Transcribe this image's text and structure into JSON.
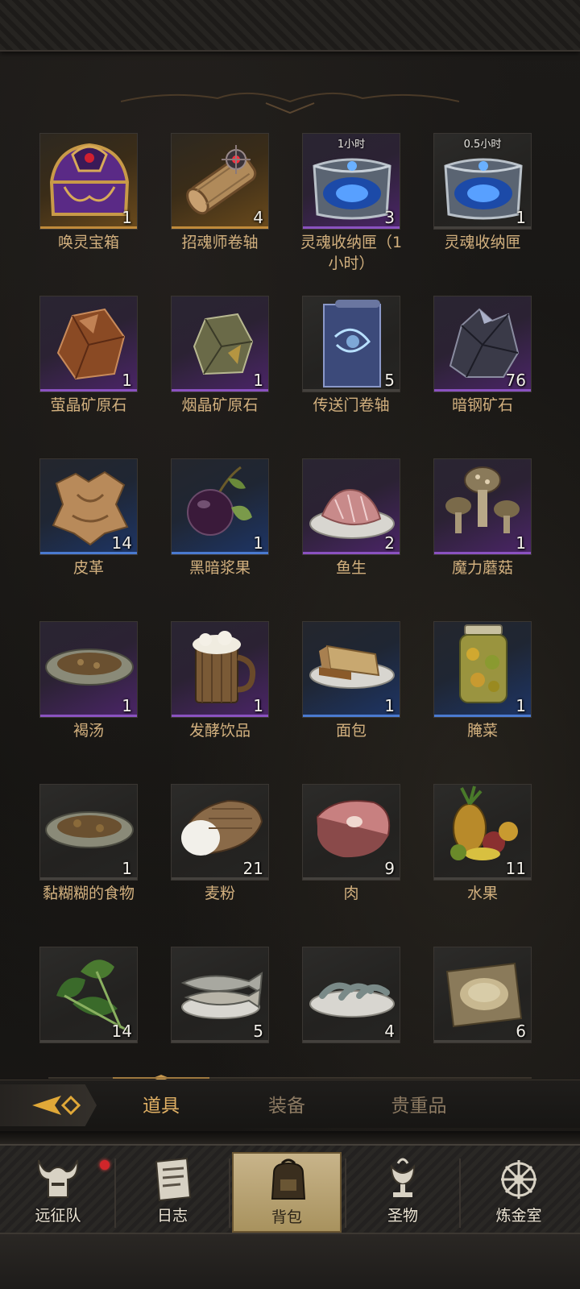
{
  "inventory": {
    "items": [
      {
        "name": "唤灵宝箱",
        "count": "1",
        "rarity": "gold",
        "icon": "purple-ornate-chest-icon"
      },
      {
        "name": "招魂师卷轴",
        "count": "4",
        "rarity": "gold",
        "icon": "scroll-with-red-gem-icon"
      },
      {
        "name": "灵魂收纳匣（1小时）",
        "count": "3",
        "rarity": "purple",
        "icon": "soul-box-icon",
        "timer": "1小时"
      },
      {
        "name": "灵魂收纳匣",
        "count": "1",
        "rarity": "gray",
        "icon": "soul-box-icon",
        "timer": "0.5小时"
      },
      {
        "name": "萤晶矿原石",
        "count": "1",
        "rarity": "purple",
        "icon": "amber-ore-icon"
      },
      {
        "name": "烟晶矿原石",
        "count": "1",
        "rarity": "purple",
        "icon": "smoky-ore-icon"
      },
      {
        "name": "传送门卷轴",
        "count": "5",
        "rarity": "gray",
        "icon": "portal-scroll-icon"
      },
      {
        "name": "暗钢矿石",
        "count": "76",
        "rarity": "purple",
        "icon": "dark-steel-ore-icon"
      },
      {
        "name": "皮革",
        "count": "14",
        "rarity": "blue",
        "icon": "leather-hide-icon"
      },
      {
        "name": "黑暗浆果",
        "count": "1",
        "rarity": "blue",
        "icon": "dark-berry-icon"
      },
      {
        "name": "鱼生",
        "count": "2",
        "rarity": "purple",
        "icon": "raw-fish-plate-icon"
      },
      {
        "name": "魔力蘑菇",
        "count": "1",
        "rarity": "purple",
        "icon": "mushroom-icon"
      },
      {
        "name": "褐汤",
        "count": "1",
        "rarity": "purple",
        "icon": "brown-soup-icon"
      },
      {
        "name": "发酵饮品",
        "count": "1",
        "rarity": "purple",
        "icon": "beer-mug-icon"
      },
      {
        "name": "面包",
        "count": "1",
        "rarity": "blue",
        "icon": "bread-icon"
      },
      {
        "name": "腌菜",
        "count": "1",
        "rarity": "blue",
        "icon": "pickle-jar-icon"
      },
      {
        "name": "黏糊糊的食物",
        "count": "1",
        "rarity": "gray",
        "icon": "mushy-food-icon"
      },
      {
        "name": "麦粉",
        "count": "21",
        "rarity": "gray",
        "icon": "flour-sack-icon"
      },
      {
        "name": "肉",
        "count": "9",
        "rarity": "gray",
        "icon": "meat-steak-icon"
      },
      {
        "name": "水果",
        "count": "11",
        "rarity": "gray",
        "icon": "fruit-pile-icon"
      },
      {
        "name": "",
        "count": "14",
        "rarity": "gray",
        "icon": "leafy-greens-icon"
      },
      {
        "name": "",
        "count": "5",
        "rarity": "gray",
        "icon": "fish-plate-icon"
      },
      {
        "name": "",
        "count": "4",
        "rarity": "gray",
        "icon": "shrimp-plate-icon"
      },
      {
        "name": "",
        "count": "6",
        "rarity": "gray",
        "icon": "grain-parchment-icon"
      }
    ]
  },
  "tabs": {
    "back_icon": "gold-arrow-icon",
    "items": [
      {
        "label": "道具",
        "active": true
      },
      {
        "label": "装备",
        "active": false
      },
      {
        "label": "贵重品",
        "active": false
      }
    ]
  },
  "nav": {
    "items": [
      {
        "label": "远征队",
        "icon": "horned-helmet-icon",
        "active": false,
        "badge": true
      },
      {
        "label": "日志",
        "icon": "journal-icon",
        "active": false,
        "badge": false
      },
      {
        "label": "背包",
        "icon": "backpack-icon",
        "active": true,
        "badge": false
      },
      {
        "label": "圣物",
        "icon": "chalice-icon",
        "active": false,
        "badge": false
      },
      {
        "label": "炼金室",
        "icon": "alchemy-icon",
        "active": false,
        "badge": false
      }
    ]
  },
  "colors": {
    "accent_gold": "#e0b064",
    "label_gold": "#d2b07e",
    "rarity_purple": "#8a52c0",
    "rarity_blue": "#4a7ad0",
    "rarity_gold": "#c08a3a",
    "badge_red": "#d0262a"
  }
}
